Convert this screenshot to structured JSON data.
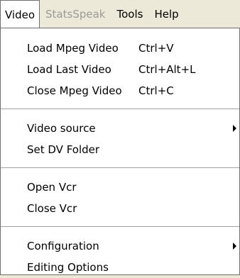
{
  "menubar": {
    "items": [
      {
        "label": "Video"
      },
      {
        "label": "StatsSpeak"
      },
      {
        "label": "Tools"
      },
      {
        "label": "Help"
      }
    ]
  },
  "menu": {
    "items": [
      {
        "label": "Load Mpeg Video",
        "shortcut": "Ctrl+V"
      },
      {
        "label": "Load Last Video",
        "shortcut": "Ctrl+Alt+L"
      },
      {
        "label": "Close Mpeg Video",
        "shortcut": "Ctrl+C"
      },
      {
        "label": "Video source",
        "submenu": true
      },
      {
        "label": "Set DV Folder"
      },
      {
        "label": "Open Vcr"
      },
      {
        "label": "Close Vcr"
      },
      {
        "label": "Configuration",
        "submenu": true
      },
      {
        "label": "Editing Options"
      }
    ]
  }
}
